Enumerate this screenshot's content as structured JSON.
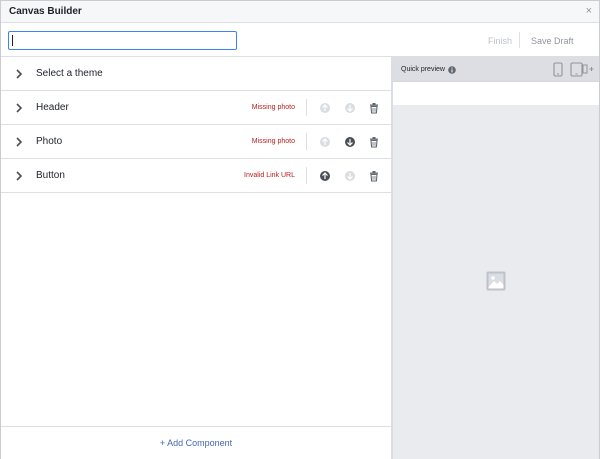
{
  "window": {
    "title": "Canvas Builder",
    "close_glyph": "×"
  },
  "toolbar": {
    "name_value": "",
    "finish_label": "Finish",
    "save_draft_label": "Save Draft"
  },
  "components": [
    {
      "label": "Select a theme",
      "warning": ""
    },
    {
      "label": "Header",
      "warning": "Missing photo",
      "move_up": "disabled",
      "move_down": "disabled"
    },
    {
      "label": "Photo",
      "warning": "Missing photo",
      "move_up": "disabled",
      "move_down": "enabled"
    },
    {
      "label": "Button",
      "warning": "Invalid Link URL",
      "move_up": "enabled",
      "move_down": "disabled"
    }
  ],
  "add_component_label": "+ Add Component",
  "preview": {
    "title": "Quick preview",
    "icons": [
      "info-icon",
      "phone-icon",
      "tablet-add-icon",
      "image-placeholder-icon"
    ]
  },
  "colors": {
    "warning": "#b71c1c",
    "link": "#4267b2",
    "focus": "#4080ff"
  }
}
